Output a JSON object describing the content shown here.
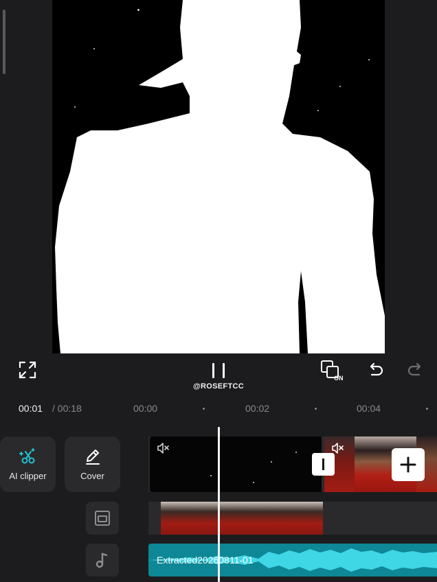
{
  "preview": {
    "watermark": "@ROSEFTCC"
  },
  "controls": {
    "fullscreen_icon": "fullscreen-icon",
    "play_pause_icon": "pause-icon",
    "cover_toggle_icon": "cover-on-icon",
    "cover_toggle_label": "ON",
    "undo_icon": "undo-icon",
    "redo_icon": "redo-icon"
  },
  "ruler": {
    "current_time": "00:01",
    "total_time": " / 00:18",
    "ticks": [
      "00:00",
      "00:02",
      "00:04"
    ]
  },
  "tools": {
    "ai_clipper_label": "AI clipper",
    "cover_label": "Cover"
  },
  "tracks": {
    "audio_label": "Extracted20260811-01"
  },
  "colors": {
    "accent": "#22c3d3",
    "background": "#1c1c1e",
    "audio": "#0e8796"
  }
}
